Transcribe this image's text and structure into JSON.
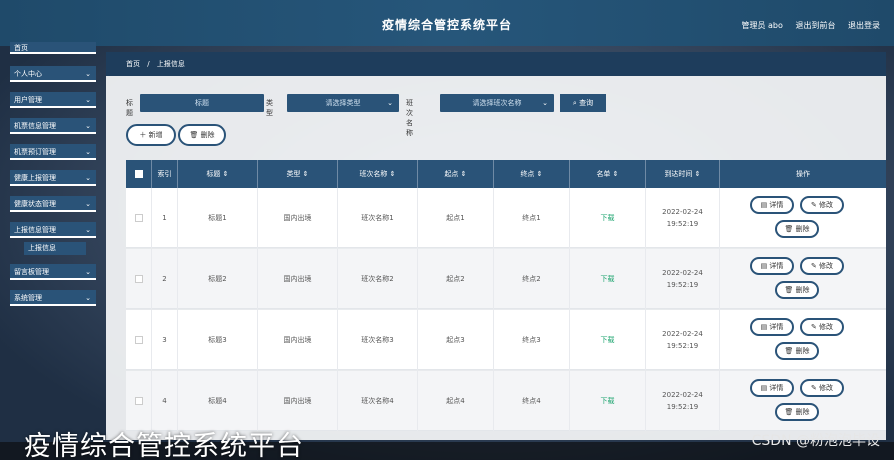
{
  "header": {
    "title": "疫情综合管控系统平台",
    "admin": "管理员 abo",
    "back": "退出到前台",
    "logout": "退出登录"
  },
  "sidebar": {
    "items": [
      {
        "label": "首页"
      },
      {
        "label": "个人中心"
      },
      {
        "label": "用户管理"
      },
      {
        "label": "机票信息管理"
      },
      {
        "label": "机票预订管理"
      },
      {
        "label": "健康上报管理"
      },
      {
        "label": "健康状态管理"
      },
      {
        "label": "上报信息管理"
      },
      {
        "label": "留言板管理"
      },
      {
        "label": "系统管理"
      }
    ],
    "sub_item": "上报信息"
  },
  "breadcrumb": {
    "home": "首页",
    "sep": "/",
    "current": "上报信息"
  },
  "filters": {
    "title_label": "标题",
    "title_placeholder": "标题",
    "type_label": "类型",
    "type_placeholder": "请选择类型",
    "flight_label": "班次名称",
    "flight_placeholder": "请选择班次名称",
    "search": "查询"
  },
  "actions": {
    "add": "新增",
    "delete": "删除"
  },
  "table": {
    "headers": [
      "索引",
      "标题",
      "类型",
      "班次名称",
      "起点",
      "终点",
      "名单",
      "到达时间",
      "操作"
    ],
    "rows": [
      {
        "index": "1",
        "title": "标题1",
        "type": "国内出境",
        "flight": "班次名称1",
        "start": "起点1",
        "end": "终点1",
        "list": "下载",
        "time": "2022-02-24 19:52:19"
      },
      {
        "index": "2",
        "title": "标题2",
        "type": "国内出境",
        "flight": "班次名称2",
        "start": "起点2",
        "end": "终点2",
        "list": "下载",
        "time": "2022-02-24 19:52:19"
      },
      {
        "index": "3",
        "title": "标题3",
        "type": "国内出境",
        "flight": "班次名称3",
        "start": "起点3",
        "end": "终点3",
        "list": "下载",
        "time": "2022-02-24 19:52:19"
      },
      {
        "index": "4",
        "title": "标题4",
        "type": "国内出境",
        "flight": "班次名称4",
        "start": "起点4",
        "end": "终点4",
        "list": "下载",
        "time": "2022-02-24 19:52:19"
      }
    ],
    "row_actions": {
      "detail": "详情",
      "edit": "修改",
      "delete": "删除"
    }
  },
  "overlay": {
    "caption": "疫情综合管控系统平台",
    "watermark": "CSDN @粉泡泡毕设"
  },
  "colors": {
    "primary": "#2a5378",
    "success": "#1aa36d"
  }
}
